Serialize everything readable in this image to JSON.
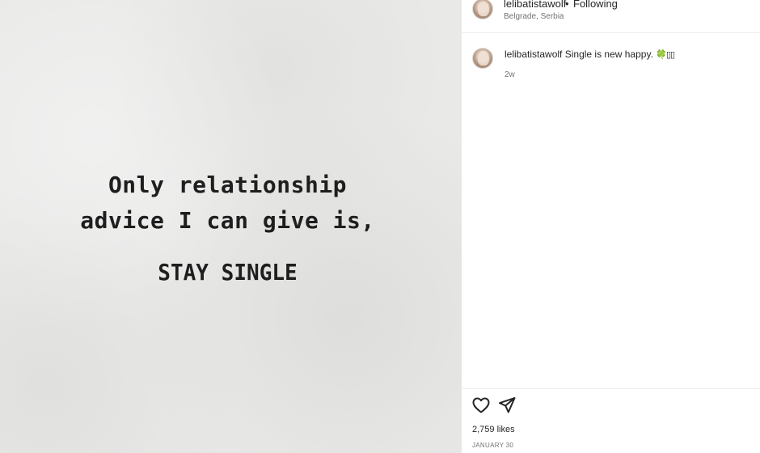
{
  "post": {
    "quote_line1": "Only relationship",
    "quote_line2": "advice I can give is,",
    "quote_line3": "STAY SINGLE"
  },
  "header": {
    "username": "lelibatistawolf",
    "separator": "•",
    "follow_status": "Following",
    "location": "Belgrade, Serbia"
  },
  "caption": {
    "username": "lelibatistawolf",
    "text": "Single is new happy.",
    "emoji": "🍀▯▯",
    "time_ago": "2w"
  },
  "actions": {
    "like_icon": "heart-icon",
    "share_icon": "paper-plane-icon"
  },
  "stats": {
    "likes_count": "2,759",
    "likes_label": "likes",
    "date": "JANUARY 30"
  }
}
